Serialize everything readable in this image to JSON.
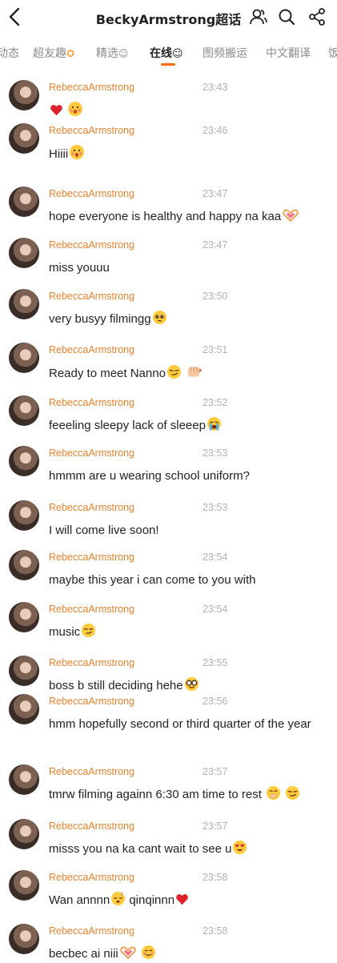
{
  "header": {
    "title": "BeckyArmstrong超话",
    "icons": [
      "back-icon",
      "user-group-icon",
      "search-icon",
      "share-icon"
    ]
  },
  "tabs": [
    {
      "label": "动态"
    },
    {
      "label": "超友趣"
    },
    {
      "label": "精选"
    },
    {
      "label": "在线"
    },
    {
      "label": "图频搬运"
    },
    {
      "label": "中文翻译"
    },
    {
      "label": "饭"
    }
  ],
  "messages": [
    {
      "user": "RebeccaArmstrong",
      "time": "23:43",
      "text": "",
      "emoji": [
        "heart-emoji",
        "kiss-emoji"
      ]
    },
    {
      "user": "RebeccaArmstrong",
      "time": "23:46",
      "text": "Hiiii",
      "emoji": [
        "kiss-emoji"
      ]
    },
    {
      "user": "RebeccaArmstrong",
      "time": "23:47",
      "text": "hope everyone is healthy and happy na kaa",
      "emoji": [
        "heart-hands-emoji"
      ]
    },
    {
      "user": "RebeccaArmstrong",
      "time": "23:47",
      "text": "miss youuu",
      "emoji": []
    },
    {
      "user": "RebeccaArmstrong",
      "time": "23:50",
      "text": "very busyy filmingg",
      "emoji": [
        "pleading-emoji"
      ]
    },
    {
      "user": "RebeccaArmstrong",
      "time": "23:51",
      "text": "Ready to meet Nanno",
      "emoji": [
        "smirk-emoji",
        "fist-emoji"
      ]
    },
    {
      "user": "RebeccaArmstrong",
      "time": "23:52",
      "text": "feeeling sleepy lack of sleeep",
      "emoji": [
        "crying-emoji"
      ]
    },
    {
      "user": "RebeccaArmstrong",
      "time": "23:53",
      "text": "hmmm are u wearing school uniform?",
      "emoji": []
    },
    {
      "user": "RebeccaArmstrong",
      "time": "23:53",
      "text": "I will come live soon!",
      "emoji": []
    },
    {
      "user": "RebeccaArmstrong",
      "time": "23:54",
      "text": "maybe this year i can come to you with",
      "emoji": []
    },
    {
      "user": "RebeccaArmstrong",
      "time": "23:54",
      "text": "music",
      "emoji": [
        "smirk-emoji"
      ]
    },
    {
      "user": "RebeccaArmstrong",
      "time": "23:55",
      "text": "boss b still deciding hehe",
      "emoji": [
        "nerd-emoji"
      ]
    },
    {
      "user": "RebeccaArmstrong",
      "time": "23:56",
      "text": "hmm hopefully second or third quarter of the year",
      "emoji": []
    },
    {
      "user": "RebeccaArmstrong",
      "time": "23:57",
      "text": "tmrw filming againn 6:30 am time to rest ",
      "emoji": [
        "shush-emoji",
        "smirk-emoji"
      ]
    },
    {
      "user": "RebeccaArmstrong",
      "time": "23:57",
      "text": "misss you na ka cant wait to see u",
      "emoji": [
        "heart-eyes-emoji"
      ]
    },
    {
      "user": "RebeccaArmstrong",
      "time": "23:58",
      "text": "Wan annnn",
      "emoji": [
        "sleeping-emoji"
      ],
      "text2": " qinqinnn",
      "emoji2": [
        "heart-emoji"
      ]
    },
    {
      "user": "RebeccaArmstrong",
      "time": "23:58",
      "text": "becbec ai niii",
      "emoji": [
        "heart-hands-emoji",
        "smiling-emoji"
      ]
    }
  ]
}
